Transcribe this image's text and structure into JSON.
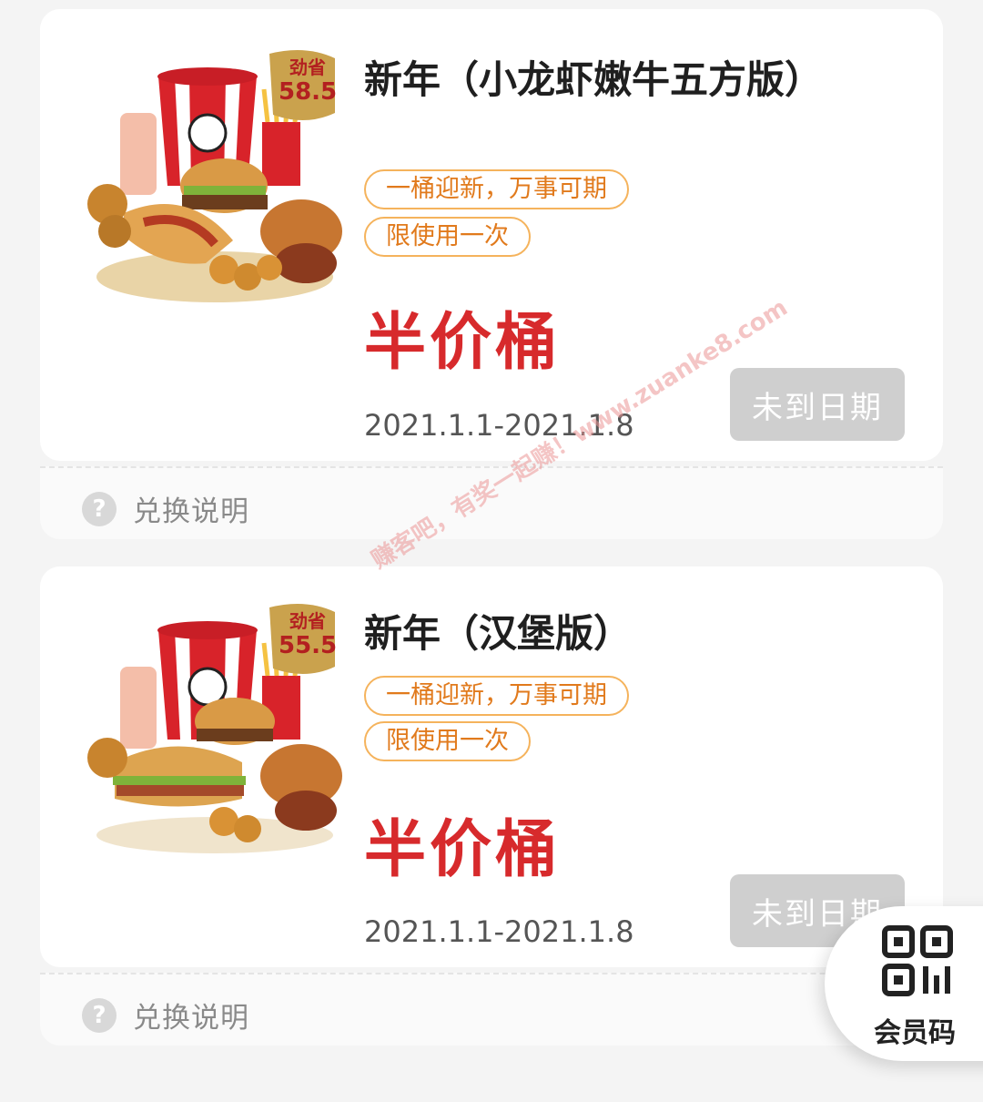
{
  "coupons": [
    {
      "badge_label": "劲省",
      "badge_amount": "58.5",
      "title": "新年（小龙虾嫩牛五方版）",
      "tags": [
        "一桶迎新，万事可期",
        "限使用一次"
      ],
      "price_label": "半价桶",
      "date_range": "2021.1.1-2021.1.8",
      "status_button": "未到日期",
      "help_label": "兑换说明"
    },
    {
      "badge_label": "劲省",
      "badge_amount": "55.5",
      "title": "新年（汉堡版）",
      "tags": [
        "一桶迎新，万事可期",
        "限使用一次"
      ],
      "price_label": "半价桶",
      "date_range": "2021.1.1-2021.1.8",
      "status_button": "未到日期",
      "help_label": "兑换说明"
    }
  ],
  "watermark": "赚客吧，有奖一起赚！www.zuanke8.com",
  "member_code": {
    "label": "会员码",
    "icon": "qr-code-icon"
  },
  "colors": {
    "price_red": "#d72a2c",
    "tag_orange": "#e17a1c",
    "tag_border": "#f5b35c",
    "disabled_grey": "#cfcfcf"
  }
}
